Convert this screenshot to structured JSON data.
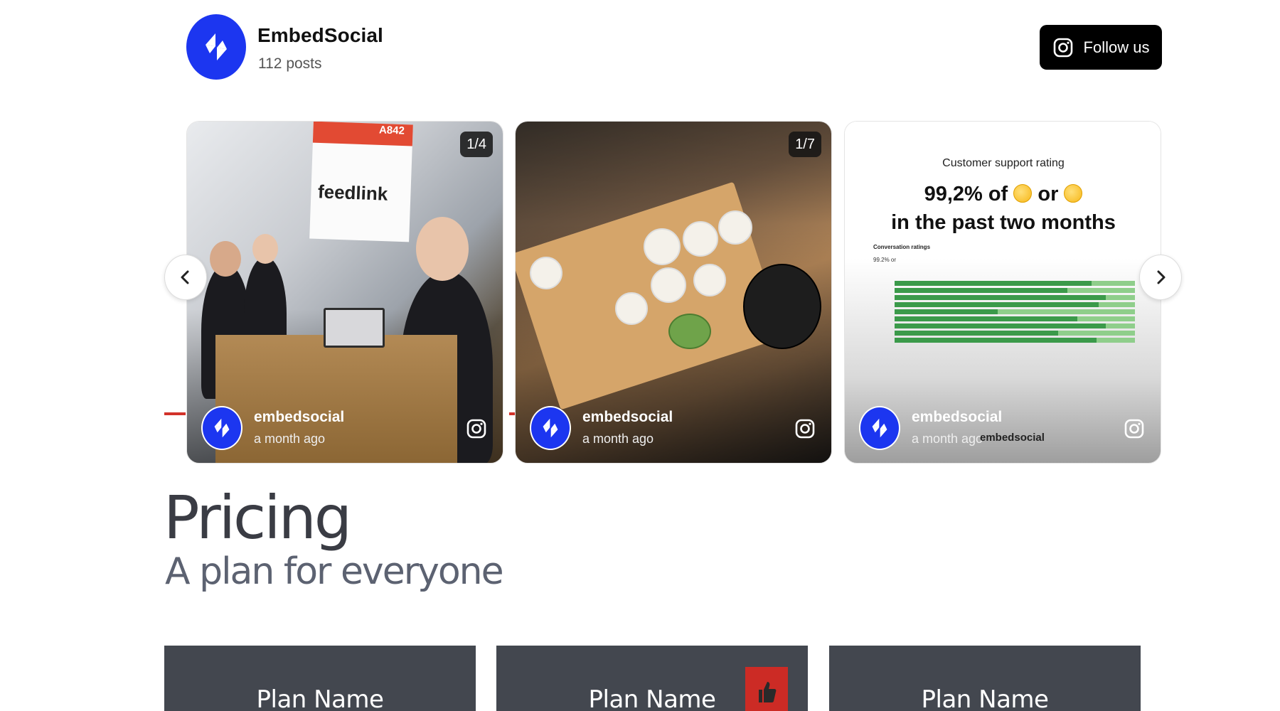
{
  "header": {
    "brand_name": "EmbedSocial",
    "posts_count": "112 posts",
    "follow_label": "Follow us"
  },
  "carousel": {
    "cards": [
      {
        "counter": "1/4",
        "sign_code": "A842",
        "sign_word": "feedlink",
        "username": "embedsocial",
        "time": "a month ago"
      },
      {
        "counter": "1/7",
        "username": "embedsocial",
        "time": "a month ago"
      },
      {
        "kicker": "Customer support rating",
        "headline_line1": "99,2% of",
        "headline_or": "or",
        "headline_line2": "in the past two months",
        "chart_title": "Conversation ratings",
        "chart_sub": "99.2%",
        "chart_sub_or": "or",
        "username": "embedsocial",
        "time": "a month ago",
        "watermark": "embedsocial"
      }
    ]
  },
  "pricing": {
    "title": "Pricing",
    "subtitle": "A plan for everyone",
    "plans": [
      {
        "name": "Plan Name"
      },
      {
        "name": "Plan Name"
      },
      {
        "name": "Plan Name"
      }
    ]
  },
  "colors": {
    "brand_blue": "#1c36f0",
    "plan_bg": "#43474f",
    "badge_red": "#cc2b25"
  },
  "icons": {
    "brand_logo": "embedsocial-logo-icon",
    "instagram": "instagram-icon",
    "prev": "chevron-left-icon",
    "next": "chevron-right-icon",
    "badge": "thumbs-up-icon"
  }
}
